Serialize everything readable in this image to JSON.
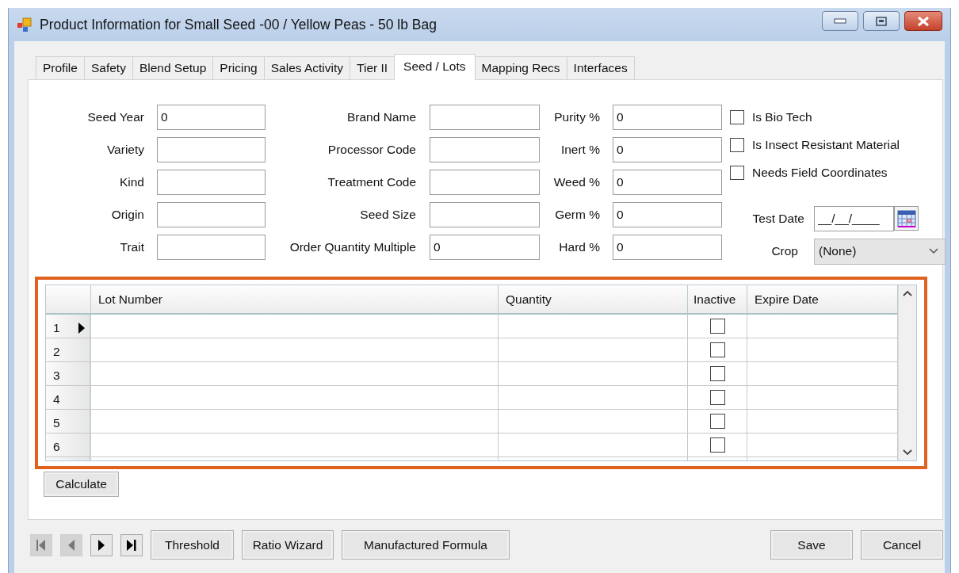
{
  "window": {
    "title": "Product Information for Small Seed -00 / Yellow Peas - 50 lb Bag"
  },
  "tabs": [
    {
      "label": "Profile",
      "selected": false
    },
    {
      "label": "Safety",
      "selected": false
    },
    {
      "label": "Blend Setup",
      "selected": false
    },
    {
      "label": "Pricing",
      "selected": false
    },
    {
      "label": "Sales Activity",
      "selected": false
    },
    {
      "label": "Tier II",
      "selected": false
    },
    {
      "label": "Seed / Lots",
      "selected": true
    },
    {
      "label": "Mapping Recs",
      "selected": false
    },
    {
      "label": "Interfaces",
      "selected": false
    }
  ],
  "form": {
    "columns": [
      [
        {
          "kind": "text",
          "label": "Seed Year",
          "value": "0"
        },
        {
          "kind": "text",
          "label": "Variety"
        },
        {
          "kind": "text",
          "label": "Kind"
        },
        {
          "kind": "text",
          "label": "Origin"
        },
        {
          "kind": "text",
          "label": "Trait"
        }
      ],
      [
        {
          "kind": "text",
          "label": "Brand Name"
        },
        {
          "kind": "text",
          "label": "Processor Code"
        },
        {
          "kind": "text",
          "label": "Treatment Code"
        },
        {
          "kind": "text",
          "label": "Seed Size"
        },
        {
          "kind": "text",
          "label": "Order Quantity Multiple",
          "value": "0"
        }
      ],
      [
        {
          "kind": "text",
          "label": "Purity %",
          "value": "0"
        },
        {
          "kind": "text",
          "label": "Inert %",
          "value": "0"
        },
        {
          "kind": "text",
          "label": "Weed %",
          "value": "0"
        },
        {
          "kind": "text",
          "label": "Germ %",
          "value": "0"
        },
        {
          "kind": "text",
          "label": "Hard %",
          "value": "0"
        }
      ],
      [
        {
          "kind": "checkbox",
          "label": "Is Bio Tech",
          "checked": false
        },
        {
          "kind": "checkbox",
          "label": "Is Insect Resistant Material",
          "checked": false
        },
        {
          "kind": "checkbox",
          "label": "Needs Field Coordinates",
          "checked": false
        },
        {
          "kind": "date",
          "label": "Test Date",
          "value": "__/__/____"
        },
        {
          "kind": "dropdown",
          "label": "Crop",
          "value": "(None)"
        }
      ]
    ]
  },
  "lots": {
    "highlighted": true,
    "columns": [
      "Lot Number",
      "Quantity",
      "Inactive",
      "Expire Date"
    ],
    "rows": [
      {
        "number": "1",
        "current": true,
        "inactive": false
      },
      {
        "number": "2",
        "current": false,
        "inactive": false
      },
      {
        "number": "3",
        "current": false,
        "inactive": false
      },
      {
        "number": "4",
        "current": false,
        "inactive": false
      },
      {
        "number": "5",
        "current": false,
        "inactive": false
      },
      {
        "number": "6",
        "current": false,
        "inactive": false
      }
    ]
  },
  "calculate_button": "Calculate",
  "footer": {
    "left_buttons": [
      "Threshold",
      "Ratio Wizard",
      "Manufactured Formula"
    ],
    "right_buttons": [
      "Save",
      "Cancel"
    ]
  }
}
